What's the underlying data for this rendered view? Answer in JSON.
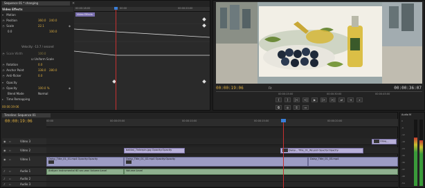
{
  "effect_controls": {
    "tab_label": "Sequence 01 * changing",
    "clip_bar_label": "Video Effects",
    "header": "Video Effects",
    "motion": "Motion",
    "position_label": "Position",
    "position_x": "360.0",
    "position_y": "240.0",
    "scale_label": "Scale",
    "scale_value": "22.1",
    "scale_min": "0.0",
    "scale_max": "100.0",
    "velocity_label": "Velocity: -13.7 / second",
    "scale_width_label": "Scale Width",
    "scale_width_value": "100.0",
    "uniform_scale_label": "Uniform Scale",
    "rotation_label": "Rotation",
    "rotation_value": "0.0",
    "anchor_label": "Anchor Point",
    "anchor_x": "338.0",
    "anchor_y": "280.0",
    "antiflicker_label": "Anti-flicker",
    "antiflicker_value": "0.0",
    "opacity_header": "Opacity",
    "opacity_label": "Opacity",
    "opacity_value": "100.0 %",
    "blend_label": "Blend Mode",
    "blend_value": "Normal",
    "time_remap_label": "Time Remapping",
    "ruler_ticks": [
      "00:00:18:00",
      "00:00",
      "00:00:20:00"
    ],
    "footer_timecode": "00:00:19:06"
  },
  "program_monitor": {
    "timecode": "00:00:19:06",
    "duration": "00:00:36:07",
    "fit": "Fit",
    "ruler_ticks": [
      "00:00:15:00",
      "00:00:30:00",
      "00:00:45:00"
    ],
    "buttons": [
      "{",
      "}",
      "|<",
      "<|",
      "▶",
      "|>",
      ">|",
      "⇄",
      "⇥",
      "⌕",
      "⧉",
      "◎",
      "⌗",
      "▭"
    ]
  },
  "timeline": {
    "tab_label": "Timeline: Sequence 01",
    "timecode": "00:00:19:06",
    "ruler_ticks": [
      "00:00",
      "00:00:05:00",
      "00:00:10:00",
      "00:00:15:00",
      "00:00:20:00",
      "00:00:25:00"
    ],
    "tracks": [
      {
        "name": "Video 3"
      },
      {
        "name": "Video 2"
      },
      {
        "name": "Video 1"
      },
      {
        "name": "Audio 1"
      },
      {
        "name": "Audio 2"
      },
      {
        "name": "Audio 3"
      }
    ],
    "clips": {
      "v3_a": "Olive...",
      "v2_a": "bakkal_7interpin.jpg Opacity:Opacity",
      "v2_b": "Daisy... Title_01_WJ.psd Opacity:Opacity",
      "v1_a": "Daisy_Title_01_01.mp4 Opacity:Opacity",
      "v1_b": "Daisy_Title_01_02.mp4 Opacity:Opacity",
      "v1_c": "Daisy_Title_01_03.mp4",
      "a1_a": "Ardiyan instrumental 60 sec.wav Volume:Level",
      "a1_b": "Volume:Level"
    }
  },
  "audio_meter": {
    "tab_label": "Audio M",
    "scale": [
      "0",
      "-6",
      "-12",
      "-18",
      "-24",
      "-30",
      "-36",
      "-42",
      "-48",
      "-54"
    ]
  }
}
